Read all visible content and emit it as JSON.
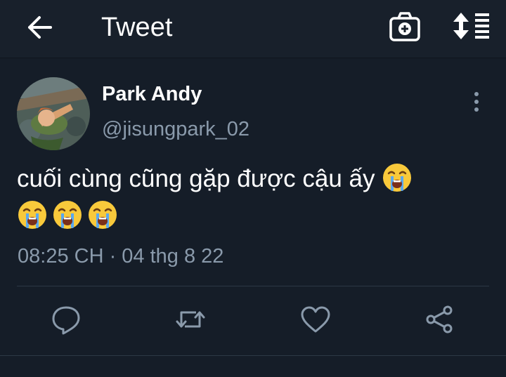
{
  "header": {
    "title": "Tweet",
    "back_icon": "arrow-left-icon",
    "camera_icon": "camera-add-icon",
    "sort_icon": "sort-list-icon"
  },
  "tweet": {
    "author_name": "Park Andy",
    "author_handle": "@jisungpark_02",
    "text_line1": "cuối cùng cũng gặp được cậu ấy",
    "emojis": [
      "loudly-crying-face",
      "loudly-crying-face",
      "loudly-crying-face",
      "loudly-crying-face"
    ],
    "timestamp": "08:25 CH · 04 thg 8 22"
  },
  "actions": {
    "reply_icon": "reply-icon",
    "retweet_icon": "retweet-icon",
    "like_icon": "heart-icon",
    "share_icon": "share-icon"
  },
  "colors": {
    "background": "#151d28",
    "header": "#18202b",
    "text": "#ffffff",
    "secondary": "#8a9aab",
    "divider": "#2c3845"
  }
}
